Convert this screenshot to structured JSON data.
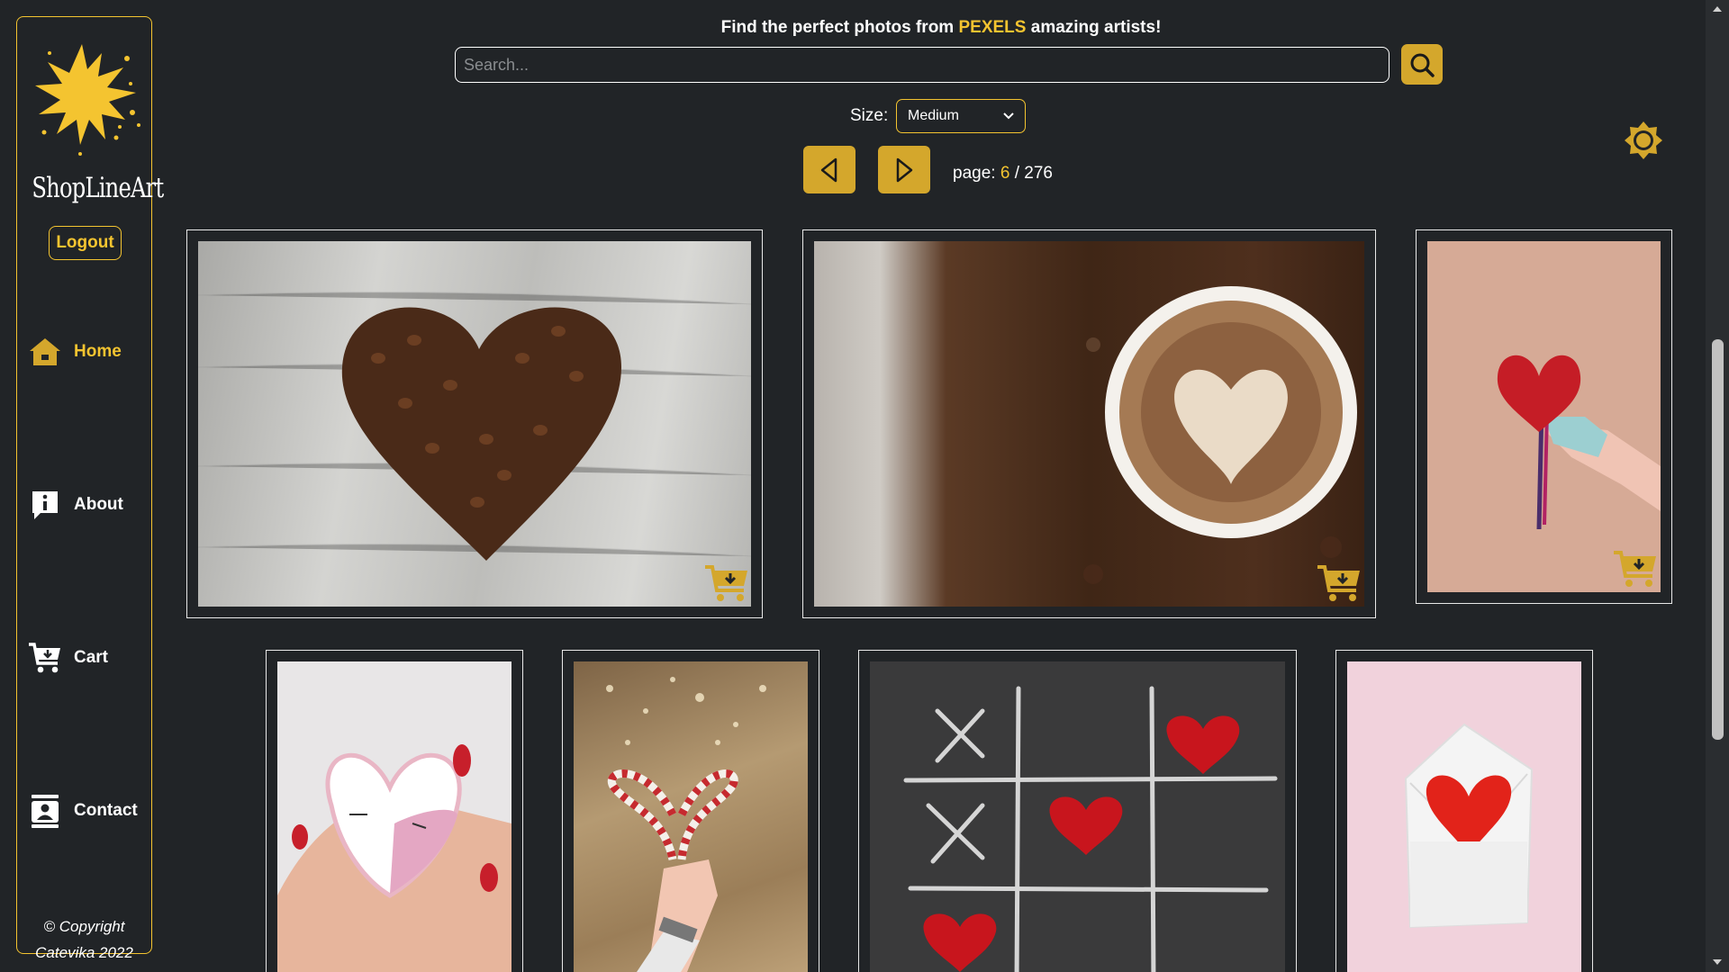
{
  "sidebar": {
    "brand": "ShopLineArt",
    "logout_label": "Logout",
    "nav": [
      {
        "label": "Home",
        "icon": "home-icon",
        "active": true
      },
      {
        "label": "About",
        "icon": "info-icon",
        "active": false
      },
      {
        "label": "Cart",
        "icon": "cart-icon",
        "active": false
      },
      {
        "label": "Contact",
        "icon": "contact-icon",
        "active": false
      }
    ],
    "copyright_line1": "© Copyright",
    "copyright_line2": "Catevika 2022"
  },
  "header": {
    "tagline_before": "Find the perfect photos from",
    "tagline_brand": "PEXELS",
    "tagline_after": "amazing artists!",
    "search_placeholder": "Search...",
    "size_label": "Size:",
    "size_value": "Medium",
    "page_prefix": "page:",
    "page_current": "6",
    "page_separator": "/",
    "page_total": "276"
  },
  "photos": [
    {
      "subject": "coffee beans heart"
    },
    {
      "subject": "latte art heart"
    },
    {
      "subject": "red heart in gloved hand"
    },
    {
      "subject": "heart cookie in hand"
    },
    {
      "subject": "candy cane heart"
    },
    {
      "subject": "tic tac toe with hearts"
    },
    {
      "subject": "heart in envelope"
    }
  ],
  "colors": {
    "accent": "#f4c430",
    "button": "#d4a72c",
    "background": "#212427"
  }
}
